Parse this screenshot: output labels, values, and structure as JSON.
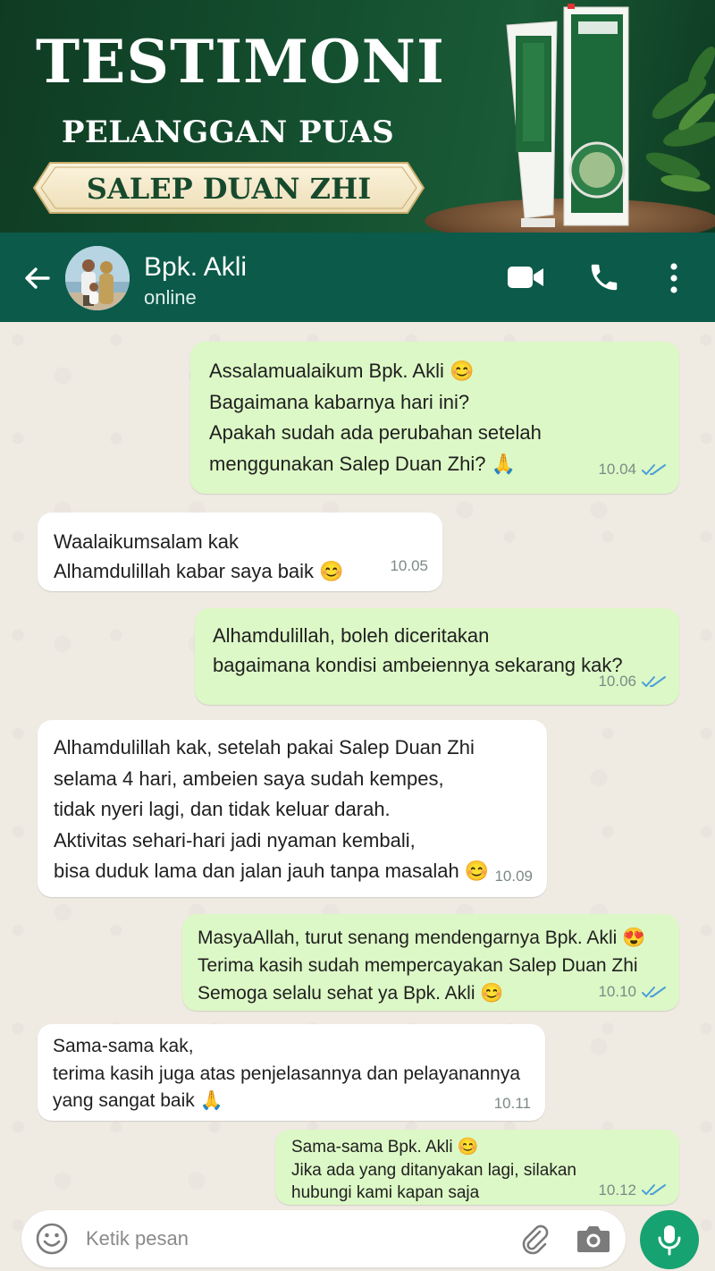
{
  "banner": {
    "title": "TESTIMONI",
    "subtitle": "PELANGGAN PUAS",
    "product_name": "SALEP DUAN ZHI"
  },
  "header": {
    "contact_name": "Bpk. Akli",
    "status": "online",
    "icons": [
      "back-arrow-icon",
      "video-call-icon",
      "phone-call-icon",
      "more-options-icon"
    ]
  },
  "messages": [
    {
      "direction": "outgoing",
      "lines": [
        "Assalamualaikum Bpk. Akli 😊",
        "Bagaimana kabarnya hari ini?",
        "Apakah sudah ada perubahan setelah",
        "menggunakan Salep Duan Zhi? 🙏"
      ],
      "time": "10.04",
      "read": true
    },
    {
      "direction": "incoming",
      "lines": [
        "Waalaikumsalam kak",
        "Alhamdulillah kabar saya baik 😊"
      ],
      "time": "10.05"
    },
    {
      "direction": "outgoing",
      "lines": [
        "Alhamdulillah, boleh diceritakan",
        "bagaimana kondisi ambeiennya sekarang kak?"
      ],
      "time": "10.06",
      "read": true
    },
    {
      "direction": "incoming",
      "lines": [
        "Alhamdulillah kak, setelah pakai Salep Duan Zhi",
        "selama 4 hari, ambeien saya sudah kempes,",
        "tidak nyeri lagi, dan tidak keluar darah.",
        "Aktivitas sehari-hari jadi nyaman kembali,",
        "bisa duduk lama dan jalan jauh tanpa masalah 😊"
      ],
      "time": "10.09"
    },
    {
      "direction": "outgoing",
      "lines": [
        "MasyaAllah, turut senang mendengarnya Bpk. Akli 😍",
        "Terima kasih sudah mempercayakan Salep Duan Zhi",
        "Semoga selalu sehat ya Bpk. Akli 😊"
      ],
      "time": "10.10",
      "read": true
    },
    {
      "direction": "incoming",
      "lines": [
        "Sama-sama kak,",
        "terima kasih juga atas penjelasannya dan pelayanannya",
        "yang sangat baik 🙏"
      ],
      "time": "10.11"
    },
    {
      "direction": "outgoing",
      "lines": [
        "Sama-sama Bpk. Akli 😊",
        "Jika ada yang ditanyakan lagi, silakan",
        "hubungi kami kapan saja"
      ],
      "time": "10.12",
      "read": true
    }
  ],
  "input": {
    "placeholder": "Ketik pesan",
    "icons": [
      "emoji-icon",
      "attach-icon",
      "camera-icon",
      "microphone-icon"
    ]
  },
  "colors": {
    "header_bg": "#0b5a4a",
    "outgoing_bubble": "#dcf8c6",
    "incoming_bubble": "#ffffff",
    "read_tick": "#4a9fd8",
    "mic_button": "#16a271",
    "banner_bg": "#145030"
  }
}
